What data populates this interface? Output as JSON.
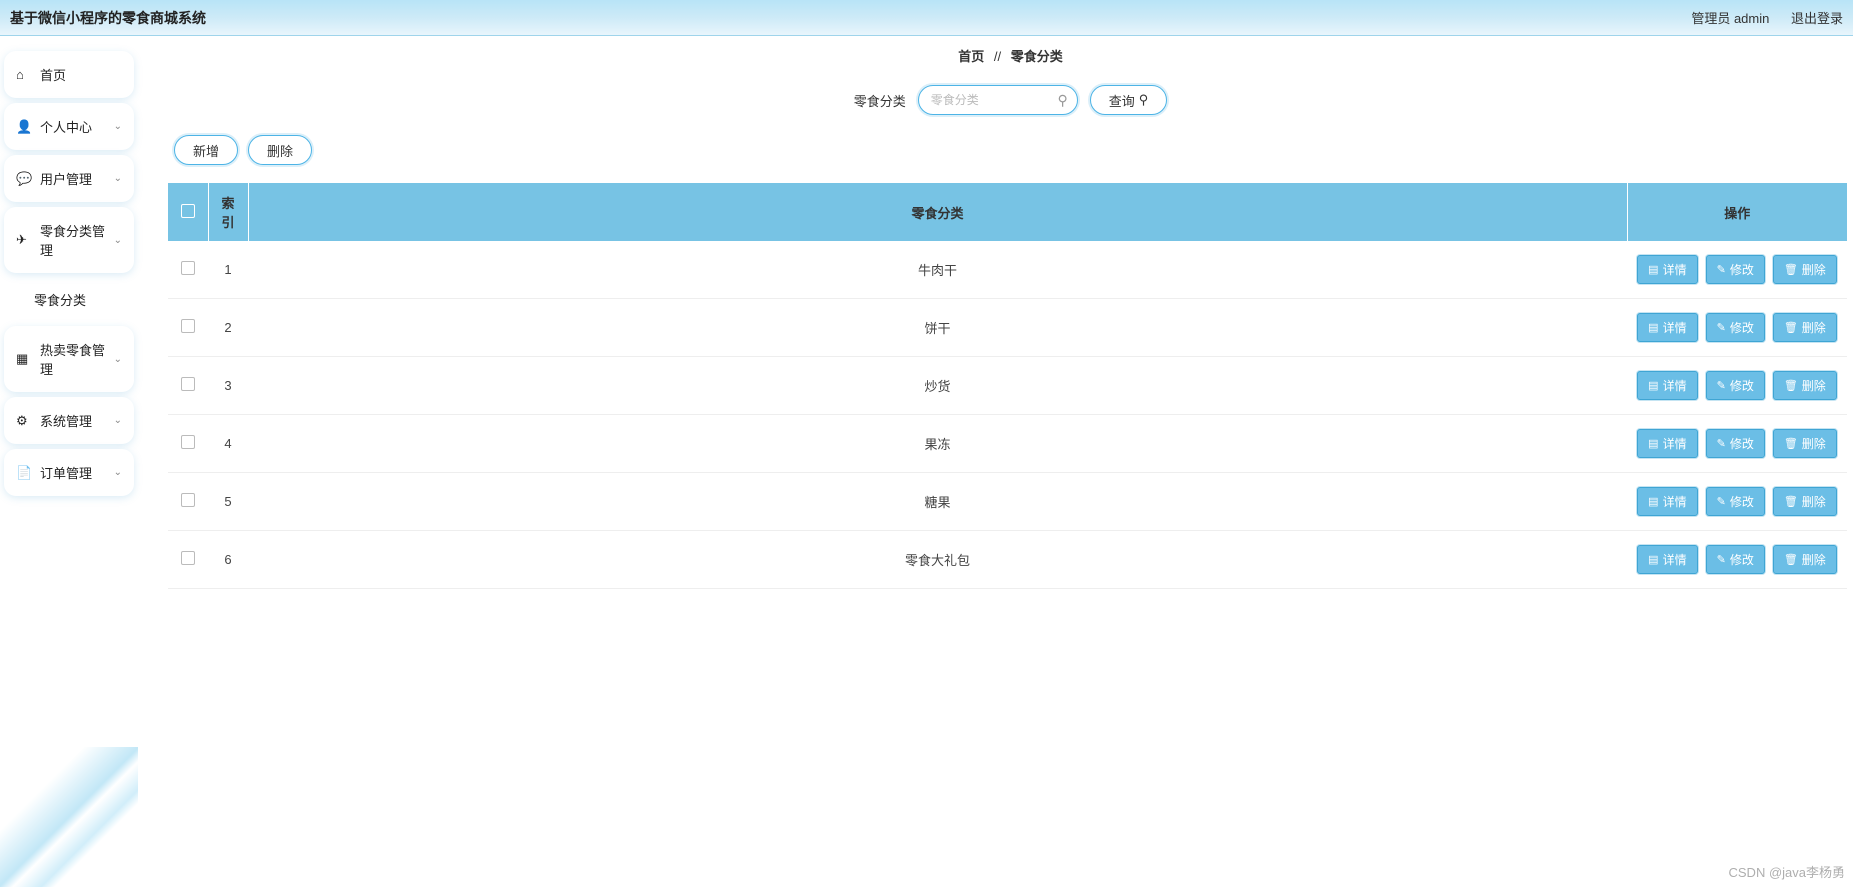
{
  "header": {
    "title": "基于微信小程序的零食商城系统",
    "user_label": "管理员 admin",
    "logout_label": "退出登录"
  },
  "sidebar": {
    "items": [
      {
        "icon": "⌂",
        "label": "首页",
        "expandable": false
      },
      {
        "icon": "👤",
        "label": "个人中心",
        "expandable": true
      },
      {
        "icon": "💬",
        "label": "用户管理",
        "expandable": true
      },
      {
        "icon": "✈",
        "label": "零食分类管理",
        "expandable": true,
        "expanded": true,
        "children": [
          {
            "label": "零食分类"
          }
        ]
      },
      {
        "icon": "▦",
        "label": "热卖零食管理",
        "expandable": true
      },
      {
        "icon": "⚙",
        "label": "系统管理",
        "expandable": true
      },
      {
        "icon": "📄",
        "label": "订单管理",
        "expandable": true
      }
    ]
  },
  "breadcrumb": {
    "home": "首页",
    "separator": "//",
    "current": "零食分类"
  },
  "search": {
    "label": "零食分类",
    "placeholder": "零食分类",
    "query_label": "查询"
  },
  "toolbar": {
    "add_label": "新增",
    "delete_label": "删除"
  },
  "table": {
    "headers": {
      "index": "索引",
      "category": "零食分类",
      "ops": "操作"
    },
    "rows": [
      {
        "index": "1",
        "category": "牛肉干"
      },
      {
        "index": "2",
        "category": "饼干"
      },
      {
        "index": "3",
        "category": "炒货"
      },
      {
        "index": "4",
        "category": "果冻"
      },
      {
        "index": "5",
        "category": "糖果"
      },
      {
        "index": "6",
        "category": "零食大礼包"
      }
    ],
    "op_labels": {
      "detail": "详情",
      "edit": "修改",
      "delete": "删除"
    }
  },
  "watermark": "CSDN @java李杨勇"
}
